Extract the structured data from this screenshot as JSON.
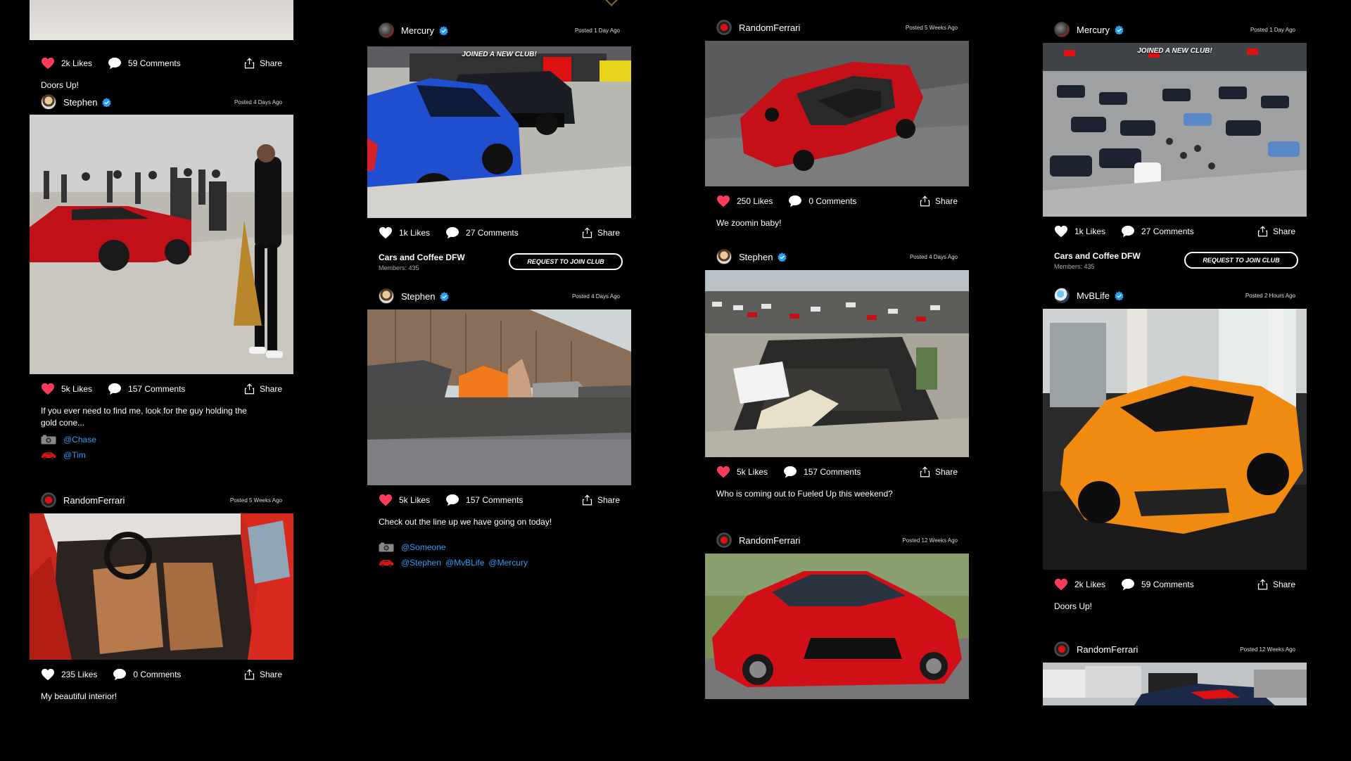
{
  "colors": {
    "accent": "#2a9df4",
    "like": "#ff3b5c",
    "background": "#000000"
  },
  "posts": {
    "c1p0": {
      "likes": "2k Likes",
      "comments": "59 Comments",
      "share": "Share",
      "caption": "Doors Up!"
    },
    "c1p1": {
      "user": "Stephen",
      "posted": "Posted 4 Days Ago",
      "likes": "5k Likes",
      "comments": "157 Comments",
      "share": "Share",
      "caption": "If you ever need to find me, look for the guy holding the gold cone...",
      "tags_photo": [
        "@Chase"
      ],
      "tags_car": [
        "@Tim"
      ]
    },
    "c1p2": {
      "user": "RandomFerrari",
      "posted": "Posted 5 Weeks Ago",
      "likes": "235  Likes",
      "comments": "0 Comments",
      "share": "Share",
      "caption": "My beautiful interior!"
    },
    "c2p0": {
      "user": "Mercury",
      "posted": "Posted 1 Day Ago",
      "overlay": "JOINED A NEW CLUB!",
      "likes": "1k Likes",
      "comments": "27 Comments",
      "share": "Share",
      "club_name": "Cars and Coffee DFW",
      "club_members": "Members: 435",
      "join_label": "REQUEST TO JOIN CLUB"
    },
    "c2p1": {
      "user": "Stephen",
      "posted": "Posted 4 Days Ago",
      "likes": "5k Likes",
      "comments": "157 Comments",
      "share": "Share",
      "caption": "Check out the line up we have going on today!",
      "tags_photo": [
        "@Someone"
      ],
      "tags_car": [
        "@Stephen",
        "@MvBLife",
        "@Mercury"
      ]
    },
    "c3p0": {
      "user": "RandomFerrari",
      "posted": "Posted 5 Weeks Ago",
      "likes": "250 Likes",
      "comments": "0 Comments",
      "share": "Share",
      "caption": "We zoomin baby!"
    },
    "c3p1": {
      "user": "Stephen",
      "posted": "Posted 4 Days Ago",
      "likes": "5k Likes",
      "comments": "157 Comments",
      "share": "Share",
      "caption": "Who is coming out to Fueled Up this weekend?"
    },
    "c3p2": {
      "user": "RandomFerrari",
      "posted": "Posted 12  Weeks Ago"
    },
    "c4p0": {
      "user": "Mercury",
      "posted": "Posted 1 Day Ago",
      "overlay": "JOINED A NEW CLUB!",
      "likes": "1k Likes",
      "comments": "27 Comments",
      "share": "Share",
      "club_name": "Cars and Coffee DFW",
      "club_members": "Members: 435",
      "join_label": "REQUEST TO JOIN CLUB"
    },
    "c4p1": {
      "user": "MvBLife",
      "posted": "Posted 2 Hours Ago",
      "likes": "2k Likes",
      "comments": "59 Comments",
      "share": "Share",
      "caption": "Doors Up!"
    },
    "c4p2": {
      "user": "RandomFerrari",
      "posted": "Posted 12  Weeks Ago"
    }
  }
}
